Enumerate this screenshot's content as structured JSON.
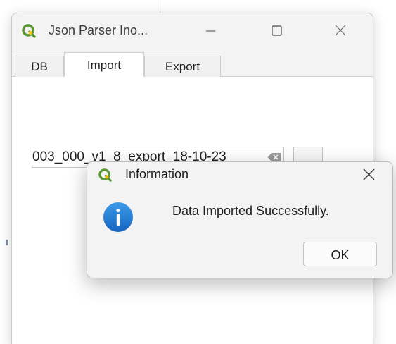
{
  "main_window": {
    "title": "Json Parser Ino...",
    "icon": "qgis-logo-icon",
    "controls": {
      "minimize_icon": "minimize-icon",
      "maximize_icon": "maximize-icon",
      "close_icon": "close-icon"
    },
    "tabs": [
      {
        "label": "DB",
        "active": false
      },
      {
        "label": "Import",
        "active": true
      },
      {
        "label": "Export",
        "active": false
      }
    ],
    "import": {
      "file_path_value": "003_000_v1_8_export_18-10-23",
      "clear_icon": "clear-input-icon",
      "browse_label": ""
    }
  },
  "info_dialog": {
    "title": "Information",
    "icon": "qgis-logo-icon",
    "close_icon": "close-icon",
    "status_icon": "info-icon",
    "message": "Data Imported Successfully.",
    "ok_label": "OK"
  },
  "colors": {
    "qgis_green": "#589632",
    "qgis_yellow": "#ee7913",
    "info_blue": "#1e7bd6"
  }
}
